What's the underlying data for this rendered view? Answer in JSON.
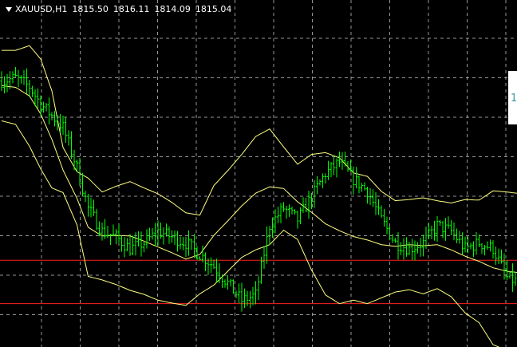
{
  "header": {
    "symbol": "XAUUSD,H1",
    "open": "1815.50",
    "high": "1816.11",
    "low": "1814.09",
    "close": "1815.04"
  },
  "side_panel_glyph": "1",
  "colors": {
    "background": "#000000",
    "grid": "#c8c8c8",
    "candle": "#00ff00",
    "bands": "#ffff80",
    "level_line": "#ff2020",
    "text": "#ffffff"
  },
  "chart_data": {
    "type": "candlestick",
    "symbol": "XAUUSD",
    "timeframe": "H1",
    "ylim": [
      1786,
      1846
    ],
    "grid": true,
    "indicator": "bollinger-bands",
    "horizontal_levels": [
      1801.0,
      1793.5
    ],
    "close_path": [
      [
        0,
        1832
      ],
      [
        5,
        1832.5
      ],
      [
        10,
        1831
      ],
      [
        14,
        1828
      ],
      [
        18,
        1826
      ],
      [
        22,
        1824
      ],
      [
        27,
        1817
      ],
      [
        31,
        1810
      ],
      [
        36,
        1806
      ],
      [
        41,
        1805
      ],
      [
        46,
        1803
      ],
      [
        51,
        1804
      ],
      [
        56,
        1806
      ],
      [
        61,
        1805
      ],
      [
        66,
        1804
      ],
      [
        71,
        1802
      ],
      [
        76,
        1800
      ],
      [
        81,
        1797
      ],
      [
        86,
        1794
      ],
      [
        91,
        1795
      ],
      [
        96,
        1807
      ],
      [
        101,
        1810
      ],
      [
        106,
        1808
      ],
      [
        111,
        1812
      ],
      [
        116,
        1816
      ],
      [
        121,
        1818
      ],
      [
        126,
        1815
      ],
      [
        131,
        1813
      ],
      [
        136,
        1808
      ],
      [
        141,
        1804
      ],
      [
        146,
        1803
      ],
      [
        151,
        1804
      ],
      [
        156,
        1807
      ],
      [
        161,
        1806
      ],
      [
        166,
        1803
      ],
      [
        171,
        1804
      ],
      [
        176,
        1803
      ],
      [
        181,
        1798
      ],
      [
        186,
        1797
      ]
    ],
    "upper_band": [
      [
        0,
        1837.3
      ],
      [
        5,
        1837.3
      ],
      [
        10,
        1838.1
      ],
      [
        14,
        1835.8
      ],
      [
        18,
        1830.3
      ],
      [
        22,
        1820.5
      ],
      [
        27,
        1816.3
      ],
      [
        31,
        1815.2
      ],
      [
        36,
        1812.8
      ],
      [
        41,
        1813.8
      ],
      [
        46,
        1814.6
      ],
      [
        51,
        1813.5
      ],
      [
        56,
        1812.5
      ],
      [
        61,
        1811.0
      ],
      [
        66,
        1809.2
      ],
      [
        71,
        1808.8
      ],
      [
        76,
        1813.9
      ],
      [
        81,
        1816.5
      ],
      [
        86,
        1819.3
      ],
      [
        91,
        1822.4
      ],
      [
        96,
        1823.7
      ],
      [
        101,
        1820.6
      ],
      [
        106,
        1817.6
      ],
      [
        111,
        1819.3
      ],
      [
        116,
        1819.6
      ],
      [
        121,
        1818.7
      ],
      [
        126,
        1816.1
      ],
      [
        131,
        1815.5
      ],
      [
        136,
        1812.9
      ],
      [
        141,
        1811.3
      ],
      [
        146,
        1811.5
      ],
      [
        151,
        1811.8
      ],
      [
        156,
        1811.3
      ],
      [
        161,
        1810.9
      ],
      [
        166,
        1811.5
      ],
      [
        171,
        1811.4
      ],
      [
        176,
        1813.0
      ],
      [
        181,
        1812.8
      ],
      [
        186,
        1812.5
      ]
    ],
    "middle_band": [
      [
        0,
        1831.2
      ],
      [
        5,
        1830.9
      ],
      [
        10,
        1829.4
      ],
      [
        14,
        1826.3
      ],
      [
        18,
        1821.9
      ],
      [
        22,
        1816.6
      ],
      [
        27,
        1811.7
      ],
      [
        31,
        1806.7
      ],
      [
        36,
        1805.2
      ],
      [
        41,
        1805.3
      ],
      [
        46,
        1805.2
      ],
      [
        51,
        1804.3
      ],
      [
        56,
        1803.3
      ],
      [
        61,
        1802.3
      ],
      [
        66,
        1801.2
      ],
      [
        71,
        1802.0
      ],
      [
        76,
        1805.3
      ],
      [
        81,
        1807.8
      ],
      [
        86,
        1810.4
      ],
      [
        91,
        1812.6
      ],
      [
        96,
        1813.7
      ],
      [
        101,
        1813.4
      ],
      [
        106,
        1811.1
      ],
      [
        111,
        1809.3
      ],
      [
        116,
        1807.3
      ],
      [
        121,
        1806.1
      ],
      [
        126,
        1805.1
      ],
      [
        131,
        1804.5
      ],
      [
        136,
        1803.7
      ],
      [
        141,
        1803.4
      ],
      [
        146,
        1803.7
      ],
      [
        151,
        1803.5
      ],
      [
        156,
        1803.7
      ],
      [
        161,
        1802.8
      ],
      [
        166,
        1801.7
      ],
      [
        171,
        1800.8
      ],
      [
        176,
        1799.7
      ],
      [
        181,
        1799.1
      ],
      [
        186,
        1798.8
      ]
    ],
    "lower_band": [
      [
        0,
        1825.1
      ],
      [
        5,
        1824.5
      ],
      [
        10,
        1820.7
      ],
      [
        14,
        1816.8
      ],
      [
        18,
        1813.5
      ],
      [
        22,
        1812.7
      ],
      [
        27,
        1807.1
      ],
      [
        31,
        1798.2
      ],
      [
        36,
        1797.6
      ],
      [
        41,
        1796.8
      ],
      [
        46,
        1795.8
      ],
      [
        51,
        1795.1
      ],
      [
        56,
        1794.1
      ],
      [
        61,
        1793.6
      ],
      [
        66,
        1793.2
      ],
      [
        71,
        1795.2
      ],
      [
        76,
        1796.7
      ],
      [
        81,
        1799.1
      ],
      [
        86,
        1801.5
      ],
      [
        91,
        1802.8
      ],
      [
        96,
        1803.7
      ],
      [
        101,
        1806.2
      ],
      [
        106,
        1804.6
      ],
      [
        111,
        1799.3
      ],
      [
        116,
        1795.0
      ],
      [
        121,
        1793.5
      ],
      [
        126,
        1794.1
      ],
      [
        131,
        1793.5
      ],
      [
        136,
        1794.5
      ],
      [
        141,
        1795.5
      ],
      [
        146,
        1795.9
      ],
      [
        151,
        1795.2
      ],
      [
        156,
        1796.1
      ],
      [
        161,
        1794.7
      ],
      [
        166,
        1791.9
      ],
      [
        171,
        1790.2
      ],
      [
        176,
        1786.4
      ],
      [
        181,
        1785.4
      ],
      [
        186,
        1785.1
      ]
    ],
    "bar_count": 187
  }
}
